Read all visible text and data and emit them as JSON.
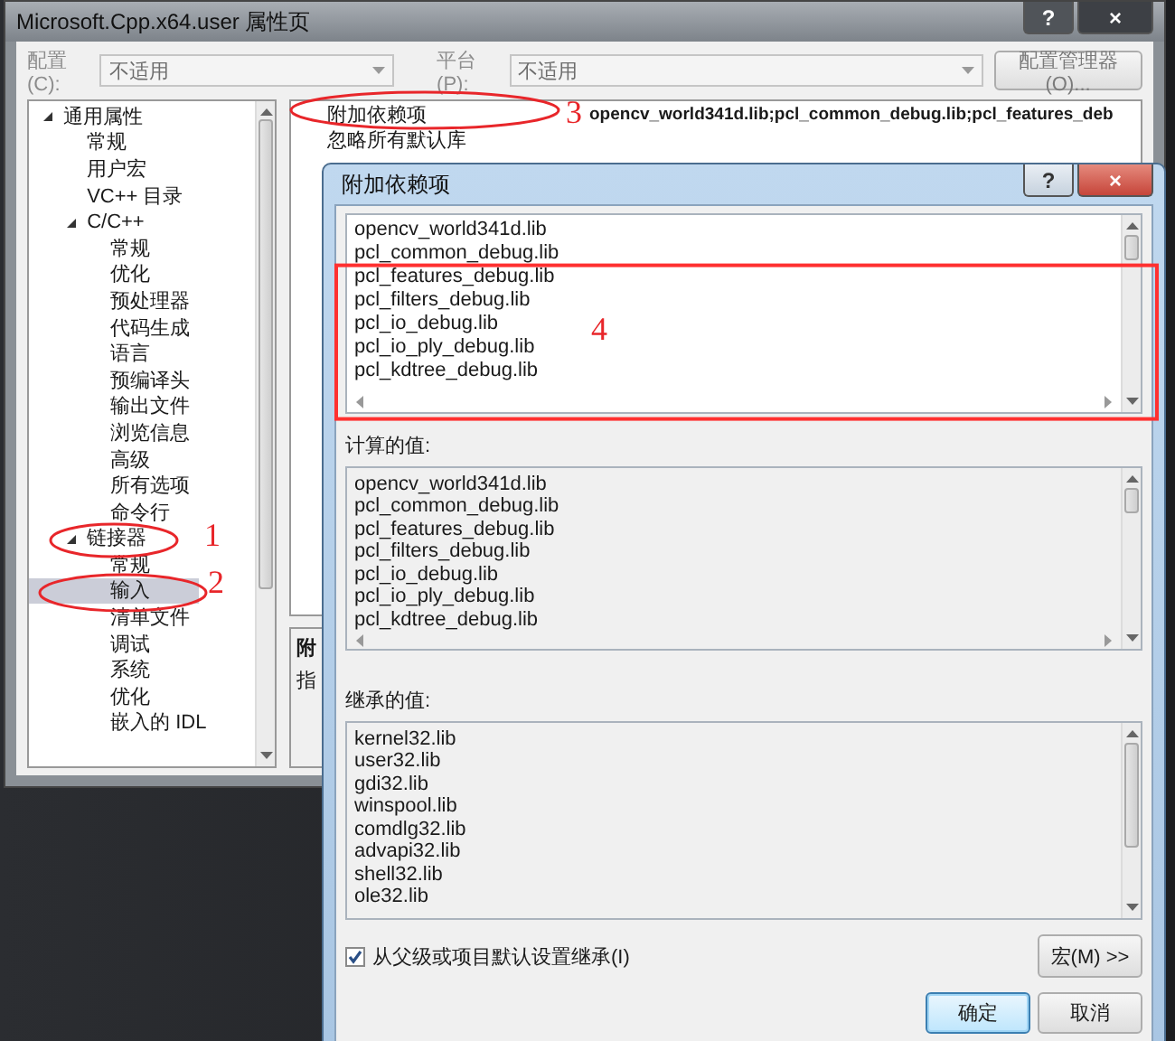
{
  "property_window": {
    "title": "Microsoft.Cpp.x64.user 属性页",
    "help_button": "?",
    "close_button": "×",
    "toolbar": {
      "disabled": true,
      "configuration_label": "配置(C):",
      "configuration_value": "不适用",
      "platform_label": "平台(P):",
      "platform_value": "不适用",
      "manager_button": "配置管理器(O)..."
    },
    "tree": [
      {
        "label": "通用属性",
        "expanded": true,
        "selected": false,
        "children": [
          {
            "label": "常规",
            "selected": false
          },
          {
            "label": "用户宏",
            "selected": false
          },
          {
            "label": "VC++ 目录",
            "selected": false
          },
          {
            "label": "C/C++",
            "expanded": true,
            "selected": false,
            "children": [
              {
                "label": "常规",
                "selected": false
              },
              {
                "label": "优化",
                "selected": false
              },
              {
                "label": "预处理器",
                "selected": false
              },
              {
                "label": "代码生成",
                "selected": false
              },
              {
                "label": "语言",
                "selected": false
              },
              {
                "label": "预编译头",
                "selected": false
              },
              {
                "label": "输出文件",
                "selected": false
              },
              {
                "label": "浏览信息",
                "selected": false
              },
              {
                "label": "高级",
                "selected": false
              },
              {
                "label": "所有选项",
                "selected": false
              },
              {
                "label": "命令行",
                "selected": false
              }
            ]
          },
          {
            "label": "链接器",
            "expanded": true,
            "selected": false,
            "children": [
              {
                "label": "常规",
                "selected": false
              },
              {
                "label": "输入",
                "selected": true
              },
              {
                "label": "清单文件",
                "selected": false
              },
              {
                "label": "调试",
                "selected": false
              },
              {
                "label": "系统",
                "selected": false
              },
              {
                "label": "优化",
                "selected": false
              },
              {
                "label": "嵌入的 IDL",
                "selected": false
              }
            ]
          }
        ]
      }
    ],
    "properties": [
      {
        "name": "附加依赖项",
        "value": "opencv_world341d.lib;pcl_common_debug.lib;pcl_features_deb"
      },
      {
        "name": "忽略所有默认库"
      }
    ],
    "description": {
      "title": "附",
      "text": "指"
    }
  },
  "dialog": {
    "title": "附加依赖项",
    "help_button": "?",
    "close_button": "×",
    "entries": [
      "opencv_world341d.lib",
      "pcl_common_debug.lib",
      "pcl_features_debug.lib",
      "pcl_filters_debug.lib",
      "pcl_io_debug.lib",
      "pcl_io_ply_debug.lib",
      "pcl_kdtree_debug.lib"
    ],
    "computed_label": "计算的值:",
    "computed_values": [
      "opencv_world341d.lib",
      "pcl_common_debug.lib",
      "pcl_features_debug.lib",
      "pcl_filters_debug.lib",
      "pcl_io_debug.lib",
      "pcl_io_ply_debug.lib",
      "pcl_kdtree_debug.lib"
    ],
    "inherited_label": "继承的值:",
    "inherited_values": [
      "kernel32.lib",
      "user32.lib",
      "gdi32.lib",
      "winspool.lib",
      "comdlg32.lib",
      "advapi32.lib",
      "shell32.lib",
      "ole32.lib"
    ],
    "inherit_checkbox": {
      "label": "从父级或项目默认设置继承(I)",
      "checked": true
    },
    "macro_button": "宏(M) >>",
    "ok_button": "确定",
    "cancel_button": "取消"
  },
  "annotations": [
    {
      "kind": "ellipse",
      "number": "1"
    },
    {
      "kind": "ellipse",
      "number": "2"
    },
    {
      "kind": "ellipse",
      "number": "3"
    },
    {
      "kind": "rectangle",
      "number": "4"
    }
  ]
}
